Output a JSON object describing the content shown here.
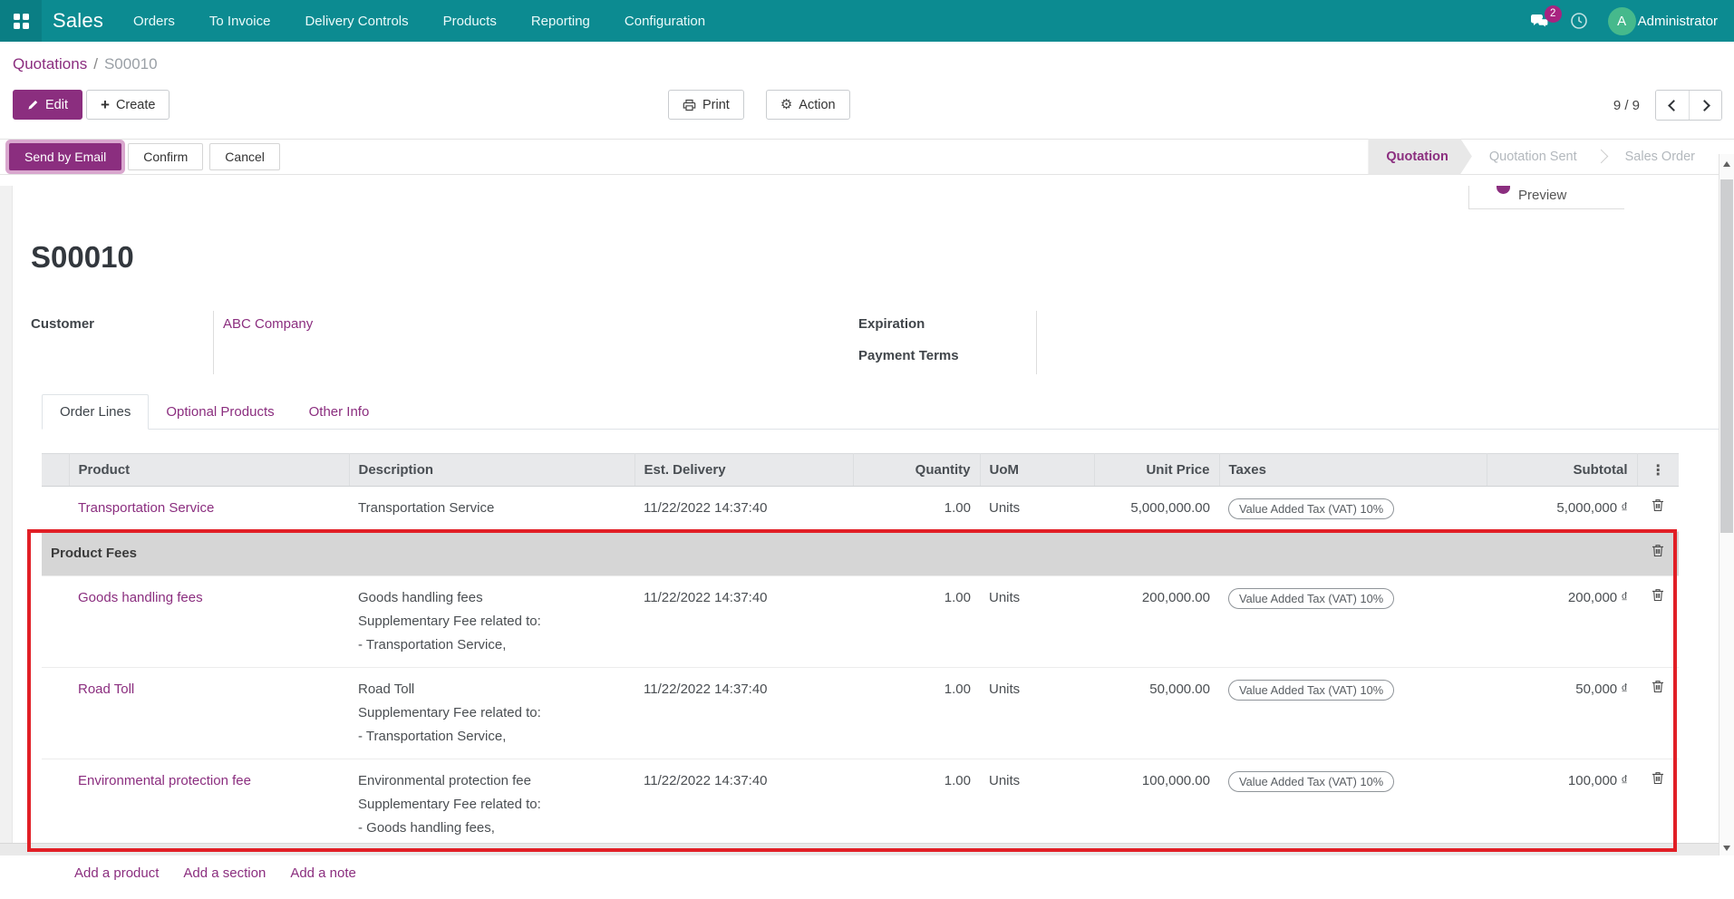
{
  "navbar": {
    "app_name": "Sales",
    "menus": [
      "Orders",
      "To Invoice",
      "Delivery Controls",
      "Products",
      "Reporting",
      "Configuration"
    ],
    "messages_badge": "2",
    "user": {
      "initial": "A",
      "name": "Administrator"
    }
  },
  "breadcrumb": {
    "parent": "Quotations",
    "separator": "/",
    "current": "S00010"
  },
  "action_bar": {
    "edit": "Edit",
    "create": "Create",
    "print": "Print",
    "action": "Action",
    "pager": "9 / 9"
  },
  "statusbar": {
    "buttons": [
      "Send by Email",
      "Confirm",
      "Cancel"
    ],
    "steps": [
      "Quotation",
      "Quotation Sent",
      "Sales Order"
    ]
  },
  "smart_button": {
    "label": "Preview"
  },
  "form": {
    "title": "S00010",
    "customer_label": "Customer",
    "customer_value": "ABC Company",
    "expiration_label": "Expiration",
    "expiration_value": "",
    "payment_terms_label": "Payment Terms",
    "payment_terms_value": ""
  },
  "tabs": [
    "Order Lines",
    "Optional Products",
    "Other Info"
  ],
  "order_lines": {
    "columns": [
      "Product",
      "Description",
      "Est. Delivery",
      "Quantity",
      "UoM",
      "Unit Price",
      "Taxes",
      "Subtotal"
    ],
    "options_icon": "⋮",
    "rows": [
      {
        "type": "product",
        "product": "Transportation Service",
        "description": [
          "Transportation Service"
        ],
        "est_delivery": "11/22/2022 14:37:40",
        "quantity": "1.00",
        "uom": "Units",
        "unit_price": "5,000,000.00",
        "taxes": "Value Added Tax (VAT) 10%",
        "subtotal": "5,000,000 ₫"
      },
      {
        "type": "section",
        "label": "Product Fees"
      },
      {
        "type": "product",
        "product": "Goods handling fees",
        "description": [
          "Goods handling fees",
          "Supplementary Fee related to:",
          " - Transportation Service,"
        ],
        "est_delivery": "11/22/2022 14:37:40",
        "quantity": "1.00",
        "uom": "Units",
        "unit_price": "200,000.00",
        "taxes": "Value Added Tax (VAT) 10%",
        "subtotal": "200,000 ₫"
      },
      {
        "type": "product",
        "product": "Road Toll",
        "description": [
          "Road Toll",
          "Supplementary Fee related to:",
          " - Transportation Service,"
        ],
        "est_delivery": "11/22/2022 14:37:40",
        "quantity": "1.00",
        "uom": "Units",
        "unit_price": "50,000.00",
        "taxes": "Value Added Tax (VAT) 10%",
        "subtotal": "50,000 ₫"
      },
      {
        "type": "product",
        "product": "Environmental protection fee",
        "description": [
          "Environmental protection fee",
          "Supplementary Fee related to:",
          " - Goods handling fees,"
        ],
        "est_delivery": "11/22/2022 14:37:40",
        "quantity": "1.00",
        "uom": "Units",
        "unit_price": "100,000.00",
        "taxes": "Value Added Tax (VAT) 10%",
        "subtotal": "100,000 ₫"
      }
    ],
    "footer_links": [
      "Add a product",
      "Add a section",
      "Add a note"
    ]
  },
  "annotation": {
    "note": "red rectangle highlighting supplementary fee lines",
    "color": "#e11f26"
  },
  "icons": {
    "action_gear": "⚙",
    "column_options": "⋮",
    "create_plus": "+"
  },
  "colors": {
    "navbar_teal": "#0c8b91",
    "accent_purple": "#8b2e7f",
    "badge_magenta": "#a82380",
    "avatar_green": "#46b98c",
    "annotation_red": "#e11f26",
    "highlight_halo": "#d9a7ce"
  }
}
